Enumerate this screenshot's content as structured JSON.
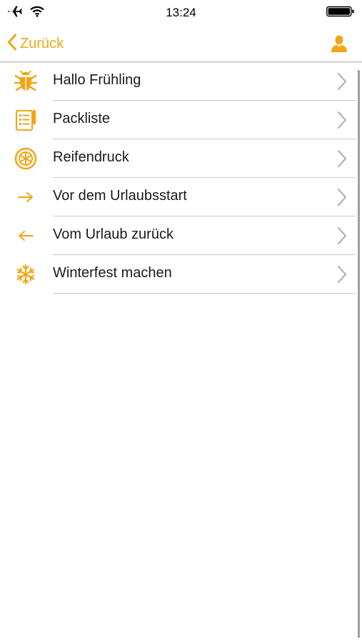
{
  "status_bar": {
    "time": "13:24",
    "icons": [
      "airplane-icon",
      "wifi-icon",
      "battery-icon"
    ]
  },
  "nav": {
    "back_label": "Zurück",
    "right_icon": "person-icon"
  },
  "colors": {
    "accent": "#f2a516",
    "text": "#1a1a1a",
    "divider": "#c8c8cc",
    "chevron": "#b3b3b3"
  },
  "list": {
    "items": [
      {
        "label": "Hallo Frühling",
        "icon": "bug-icon"
      },
      {
        "label": "Packliste",
        "icon": "checklist-icon"
      },
      {
        "label": "Reifendruck",
        "icon": "tire-icon"
      },
      {
        "label": "Vor dem Urlaubsstart",
        "icon": "arrow-right-icon"
      },
      {
        "label": "Vom Urlaub zurück",
        "icon": "arrow-left-icon"
      },
      {
        "label": "Winterfest machen",
        "icon": "snowflake-icon"
      }
    ]
  }
}
